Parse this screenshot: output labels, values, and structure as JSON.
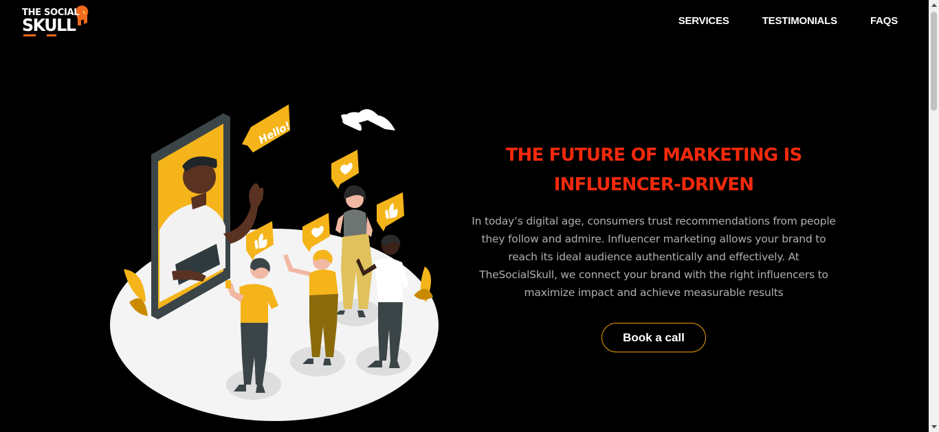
{
  "brand": {
    "line1": "THE SOCIAL",
    "line2": "SKULL"
  },
  "nav": {
    "items": [
      "SERVICES",
      "TESTIMONIALS",
      "FAQS"
    ]
  },
  "illustration": {
    "bubble_text": "Hello!"
  },
  "hero": {
    "title_line1": "THE FUTURE OF MARKETING IS",
    "title_line2": "INFLUENCER-DRIVEN",
    "description": "In today’s digital age, consumers trust recommendations from people they follow and admire. Influencer marketing allows your brand to reach its ideal audience authentically and effectively. At TheSocialSkull, we connect your brand with the right influencers to maximize impact and achieve measurable results",
    "cta_label": "Book a call"
  },
  "colors": {
    "background": "#000000",
    "accent_red": "#f2290c",
    "accent_yellow": "#f4b41a",
    "cta_border": "#f4a000",
    "body_text": "#b0b0b0"
  }
}
